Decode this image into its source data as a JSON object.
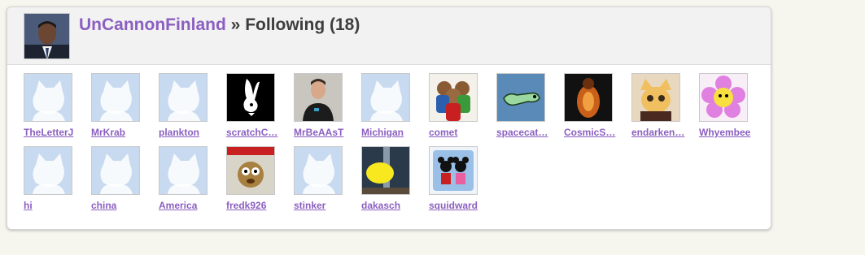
{
  "header": {
    "username": "UnCannonFinland",
    "separator": "»",
    "section_label": "Following (18)"
  },
  "users": [
    {
      "name": "TheLetterJ",
      "icon": "scratch-cat-default-avatar"
    },
    {
      "name": "MrKrab",
      "icon": "scratch-cat-default-avatar"
    },
    {
      "name": "plankton",
      "icon": "scratch-cat-default-avatar"
    },
    {
      "name": "scratchC…",
      "icon": "playboy-bunny-avatar"
    },
    {
      "name": "MrBeAAsT",
      "icon": "person-photo-avatar"
    },
    {
      "name": "Michigan",
      "icon": "scratch-cat-default-avatar"
    },
    {
      "name": "comet",
      "icon": "chipmunks-avatar"
    },
    {
      "name": "spacecat…",
      "icon": "green-lizard-avatar"
    },
    {
      "name": "CosmicS…",
      "icon": "glowing-figure-avatar"
    },
    {
      "name": "endarken…",
      "icon": "cartoon-character-avatar"
    },
    {
      "name": "Whyembee",
      "icon": "flower-character-avatar"
    },
    {
      "name": "hi",
      "icon": "scratch-cat-default-avatar"
    },
    {
      "name": "china",
      "icon": "scratch-cat-default-avatar"
    },
    {
      "name": "America",
      "icon": "scratch-cat-default-avatar"
    },
    {
      "name": "fredk926",
      "icon": "live-reaction-avatar"
    },
    {
      "name": "stinker",
      "icon": "scratch-cat-default-avatar"
    },
    {
      "name": "dakasch",
      "icon": "yellow-blob-avatar"
    },
    {
      "name": "squidward",
      "icon": "mickey-minnie-avatar"
    }
  ],
  "colors": {
    "link": "#8b5fc0",
    "title": "#3d3d3d",
    "header_bg": "#f2f2f2",
    "page_bg": "#f6f5ee"
  }
}
